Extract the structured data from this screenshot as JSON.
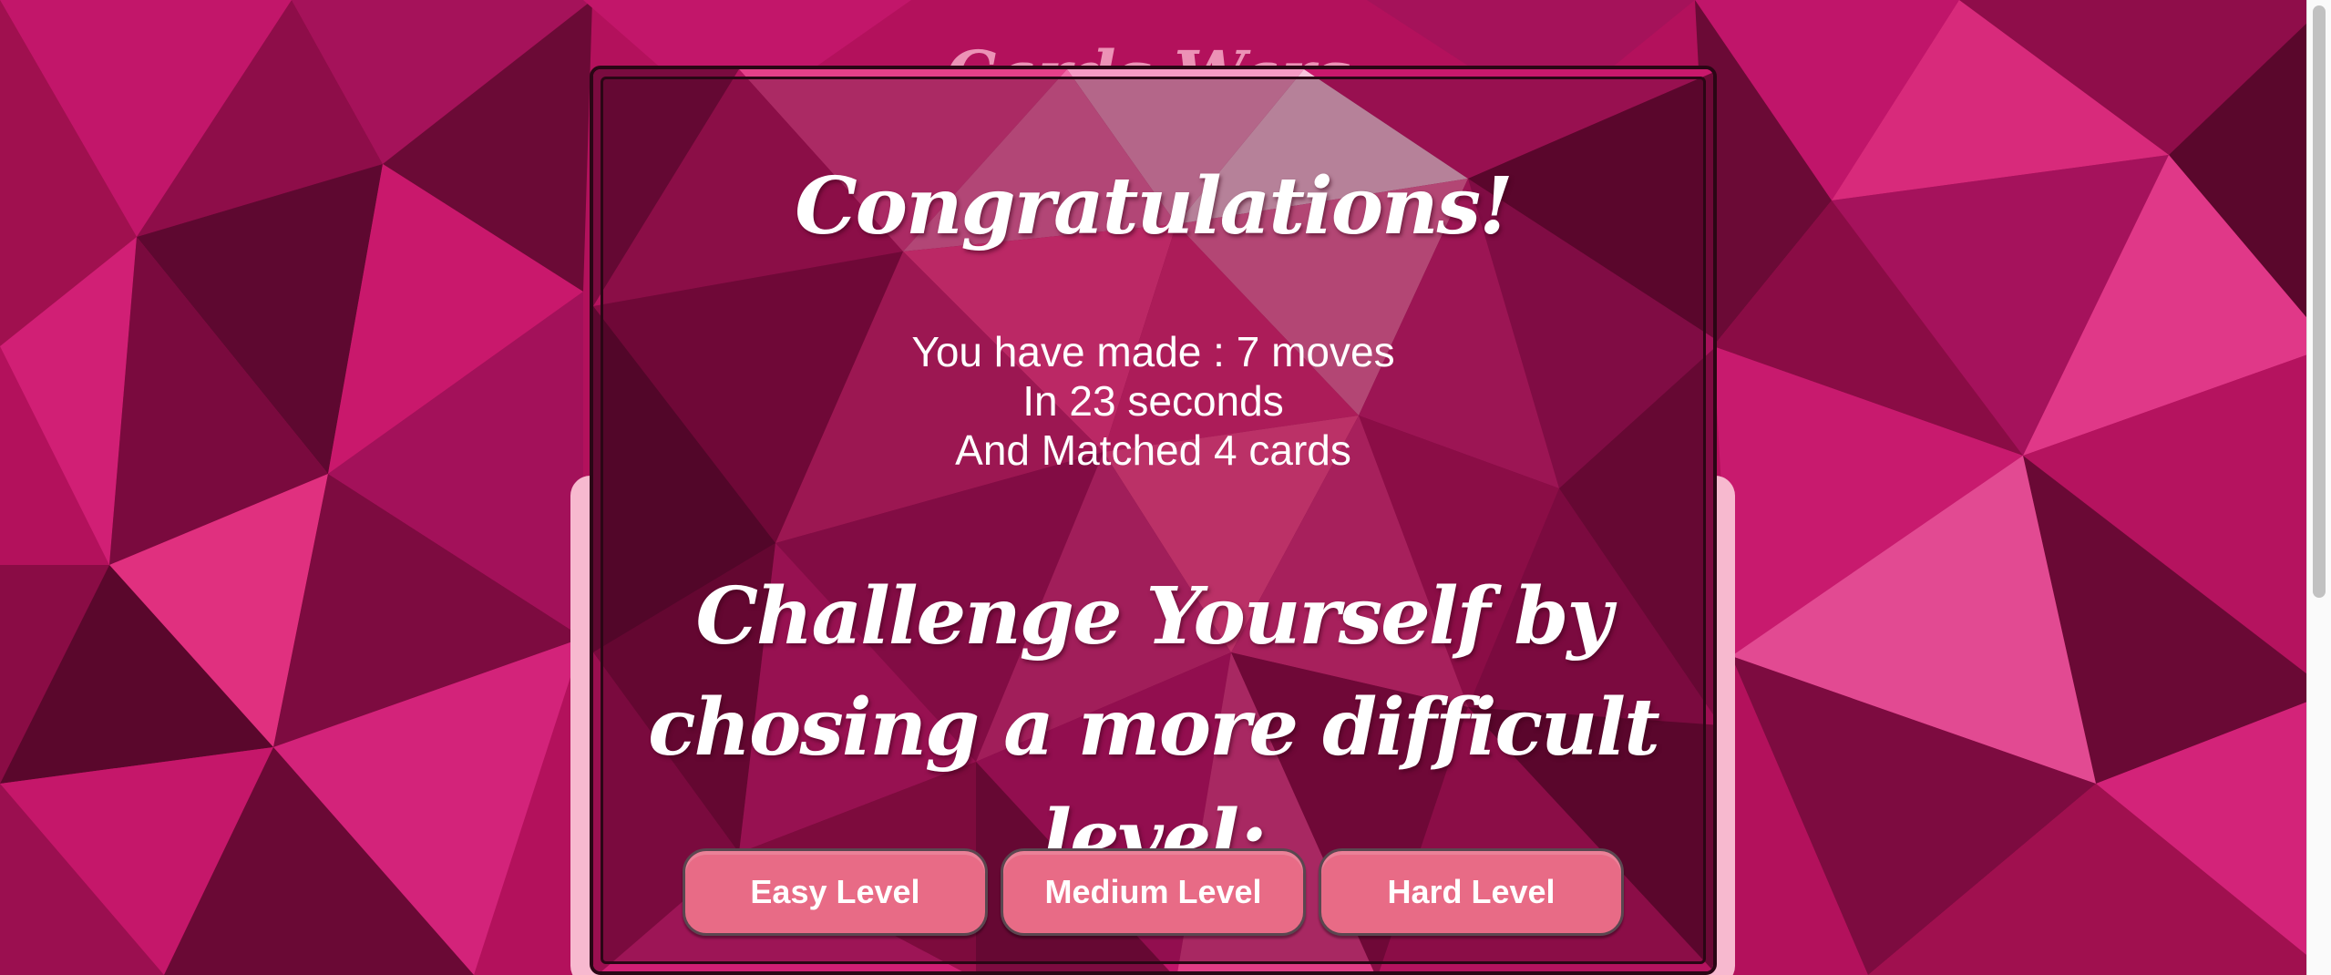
{
  "page": {
    "title_behind": "Cards Wars"
  },
  "modal": {
    "heading": "Congratulations!",
    "stats": {
      "moves_line": "You have made : 7 moves",
      "time_line": "In 23 seconds",
      "matched_line": "And Matched 4 cards"
    },
    "challenge_text": "Challenge Yourself by chosing a more difficult level:",
    "levels": [
      {
        "label": "Easy Level"
      },
      {
        "label": "Medium Level"
      },
      {
        "label": "Hard Level"
      }
    ]
  },
  "colors": {
    "background": "#b0105a",
    "board": "#f7b9cf",
    "button": "#e86b86",
    "text": "#ffffff"
  }
}
